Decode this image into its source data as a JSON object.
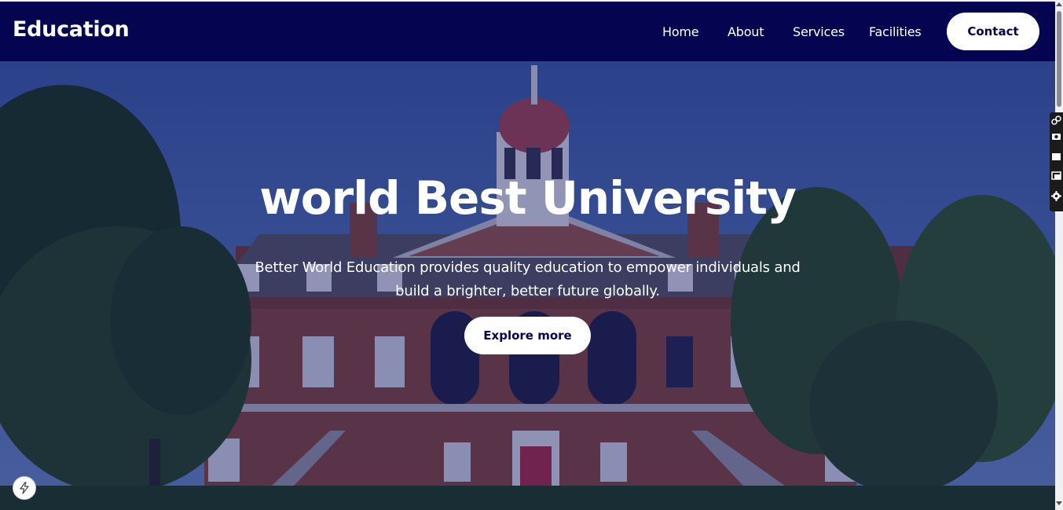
{
  "navbar": {
    "brand": "Education",
    "links": [
      {
        "label": "Home"
      },
      {
        "label": "About"
      },
      {
        "label": "Services"
      },
      {
        "label": "Facilities"
      }
    ],
    "contact_label": "Contact"
  },
  "hero": {
    "title": "world Best University",
    "subtitle": "Better World Education provides quality education to empower individuals and build a brighter, better future globally.",
    "cta_label": "Explore more"
  },
  "colors": {
    "navbar_bg": "#050450",
    "button_bg": "#ffffff",
    "button_text": "#050450",
    "hero_overlay": "rgba(10, 15, 90, 0.38)"
  },
  "icons": {
    "side_tools": [
      "link-icon",
      "camera-icon",
      "rectangle-icon",
      "window-icon",
      "gear-icon"
    ],
    "badge": "lightning-icon"
  }
}
